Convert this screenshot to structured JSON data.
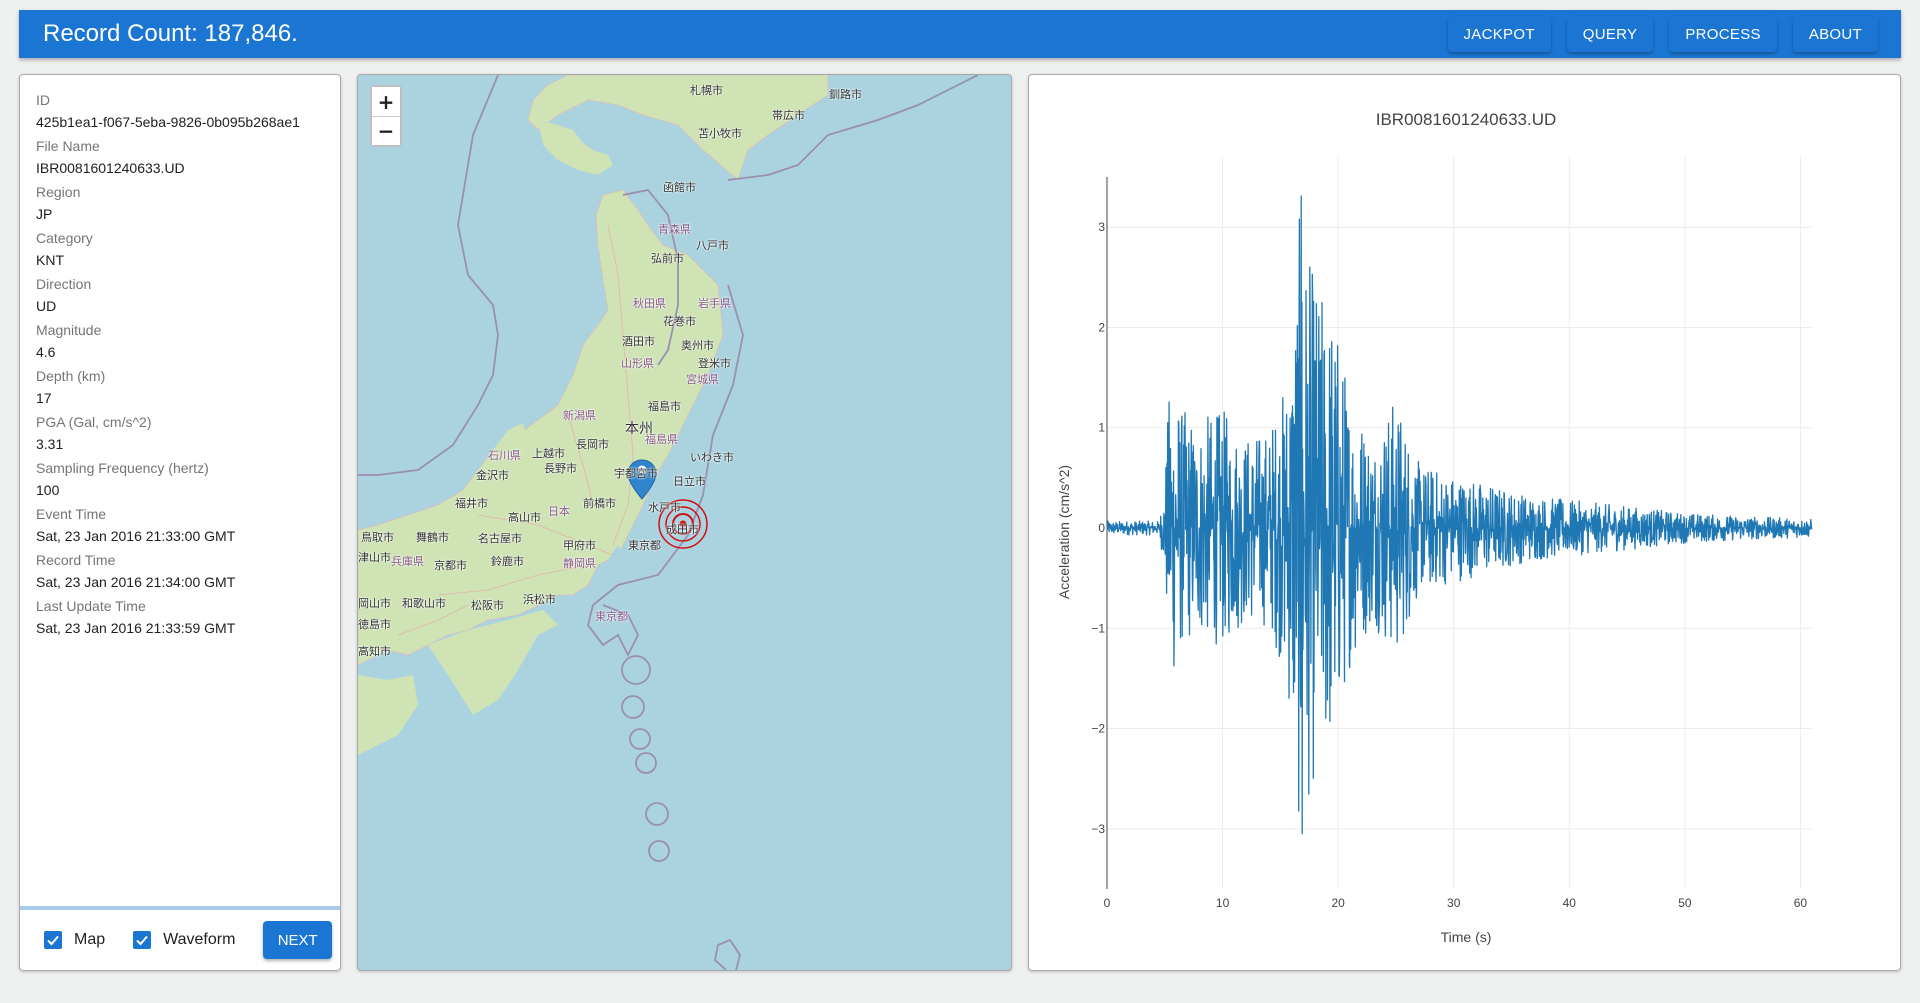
{
  "header": {
    "title": "Record Count: 187,846.",
    "nav": [
      "JACKPOT",
      "QUERY",
      "PROCESS",
      "ABOUT"
    ]
  },
  "record": {
    "fields": [
      {
        "label": "ID",
        "value": "425b1ea1-f067-5eba-9826-0b095b268ae1"
      },
      {
        "label": "File Name",
        "value": "IBR0081601240633.UD"
      },
      {
        "label": "Region",
        "value": "JP"
      },
      {
        "label": "Category",
        "value": "KNT"
      },
      {
        "label": "Direction",
        "value": "UD"
      },
      {
        "label": "Magnitude",
        "value": "4.6"
      },
      {
        "label": "Depth (km)",
        "value": "17"
      },
      {
        "label": "PGA (Gal, cm/s^2)",
        "value": "3.31"
      },
      {
        "label": "Sampling Frequency (hertz)",
        "value": "100"
      },
      {
        "label": "Event Time",
        "value": "Sat, 23 Jan 2016 21:33:00 GMT"
      },
      {
        "label": "Record Time",
        "value": "Sat, 23 Jan 2016 21:34:00 GMT"
      },
      {
        "label": "Last Update Time",
        "value": "Sat, 23 Jan 2016 21:33:59 GMT"
      }
    ],
    "footer": {
      "map_checkbox": {
        "label": "Map",
        "checked": true
      },
      "waveform_checkbox": {
        "label": "Waveform",
        "checked": true
      },
      "next_label": "NEXT"
    }
  },
  "map": {
    "zoom_in": "+",
    "zoom_out": "−",
    "station_marker": "station-pin",
    "epicenter_marker": "epicenter-rings",
    "colors": {
      "water": "#aad3df",
      "land": "#cfe3b5",
      "epicenter": "#d01010",
      "marker": "#2f84cc"
    },
    "labels": [
      {
        "text": "札幌市",
        "cls": ""
      },
      {
        "text": "釧路市",
        "cls": ""
      },
      {
        "text": "帯広市",
        "cls": ""
      },
      {
        "text": "苫小牧市",
        "cls": ""
      },
      {
        "text": "函館市",
        "cls": ""
      },
      {
        "text": "青森県",
        "cls": "pref"
      },
      {
        "text": "八戸市",
        "cls": ""
      },
      {
        "text": "弘前市",
        "cls": ""
      },
      {
        "text": "秋田県",
        "cls": "pref"
      },
      {
        "text": "岩手県",
        "cls": "pref"
      },
      {
        "text": "花巻市",
        "cls": ""
      },
      {
        "text": "酒田市",
        "cls": ""
      },
      {
        "text": "奥州市",
        "cls": ""
      },
      {
        "text": "山形県",
        "cls": "pref"
      },
      {
        "text": "登米市",
        "cls": ""
      },
      {
        "text": "宮城県",
        "cls": "pref"
      },
      {
        "text": "福島市",
        "cls": ""
      },
      {
        "text": "新潟県",
        "cls": "pref"
      },
      {
        "text": "本州",
        "cls": "big"
      },
      {
        "text": "福島県",
        "cls": "pref"
      },
      {
        "text": "長岡市",
        "cls": ""
      },
      {
        "text": "いわき市",
        "cls": ""
      },
      {
        "text": "石川県",
        "cls": "pref"
      },
      {
        "text": "上越市",
        "cls": ""
      },
      {
        "text": "長野市",
        "cls": ""
      },
      {
        "text": "宇都宮市",
        "cls": ""
      },
      {
        "text": "日立市",
        "cls": ""
      },
      {
        "text": "金沢市",
        "cls": ""
      },
      {
        "text": "福井市",
        "cls": ""
      },
      {
        "text": "前橋市",
        "cls": ""
      },
      {
        "text": "水戸市",
        "cls": ""
      },
      {
        "text": "日本",
        "cls": "pref"
      },
      {
        "text": "高山市",
        "cls": ""
      },
      {
        "text": "成田市",
        "cls": ""
      },
      {
        "text": "鳥取市",
        "cls": ""
      },
      {
        "text": "舞鶴市",
        "cls": ""
      },
      {
        "text": "名古屋市",
        "cls": ""
      },
      {
        "text": "甲府市",
        "cls": ""
      },
      {
        "text": "東京都",
        "cls": ""
      },
      {
        "text": "津山市",
        "cls": ""
      },
      {
        "text": "兵庫県",
        "cls": "pref"
      },
      {
        "text": "京都市",
        "cls": ""
      },
      {
        "text": "鈴鹿市",
        "cls": ""
      },
      {
        "text": "静岡県",
        "cls": "pref"
      },
      {
        "text": "岡山市",
        "cls": ""
      },
      {
        "text": "和歌山市",
        "cls": ""
      },
      {
        "text": "松阪市",
        "cls": ""
      },
      {
        "text": "浜松市",
        "cls": ""
      },
      {
        "text": "東京都",
        "cls": "pref"
      },
      {
        "text": "徳島市",
        "cls": ""
      },
      {
        "text": "高知市",
        "cls": ""
      }
    ]
  },
  "chart_data": {
    "type": "line",
    "title": "IBR0081601240633.UD",
    "xlabel": "Time (s)",
    "ylabel": "Acceleration (cm/s^2)",
    "xlim": [
      0,
      61
    ],
    "ylim": [
      -3.6,
      3.7
    ],
    "xticks": [
      0,
      10,
      20,
      30,
      40,
      50,
      60
    ],
    "yticks": [
      -3,
      -2,
      -1,
      0,
      1,
      2,
      3
    ],
    "grid": true,
    "series_color": "#1f77b4",
    "sampling_hz": 100,
    "envelope": {
      "description": "Acceleration waveform: quiet noise until ~4.8 s (P-wave onset), ~±1.0–1.7 cm/s^2 between 5–15 s, strong S-wave burst peaking ~3.3 / -3.05 cm/s^2 at ~16.8 s, exponential decay to ~±0.1 cm/s^2 by 61 s",
      "points": [
        [
          0,
          0.07
        ],
        [
          4.5,
          0.07
        ],
        [
          4.9,
          0.35
        ],
        [
          5.5,
          1.65
        ],
        [
          6.5,
          1.2
        ],
        [
          8,
          1.1
        ],
        [
          10,
          1.2
        ],
        [
          12,
          0.95
        ],
        [
          14,
          1.0
        ],
        [
          15.5,
          1.5
        ],
        [
          16.8,
          3.31
        ],
        [
          17.5,
          2.7
        ],
        [
          18.5,
          2.4
        ],
        [
          19.5,
          2.3
        ],
        [
          21,
          1.4
        ],
        [
          23,
          0.95
        ],
        [
          25,
          1.35
        ],
        [
          27,
          0.65
        ],
        [
          30,
          0.55
        ],
        [
          33,
          0.45
        ],
        [
          36,
          0.35
        ],
        [
          40,
          0.28
        ],
        [
          45,
          0.22
        ],
        [
          50,
          0.15
        ],
        [
          55,
          0.12
        ],
        [
          61,
          0.09
        ]
      ],
      "peak_positive": {
        "t": 16.8,
        "value": 3.31
      },
      "peak_negative": {
        "t": 16.9,
        "value": -3.05
      }
    }
  }
}
